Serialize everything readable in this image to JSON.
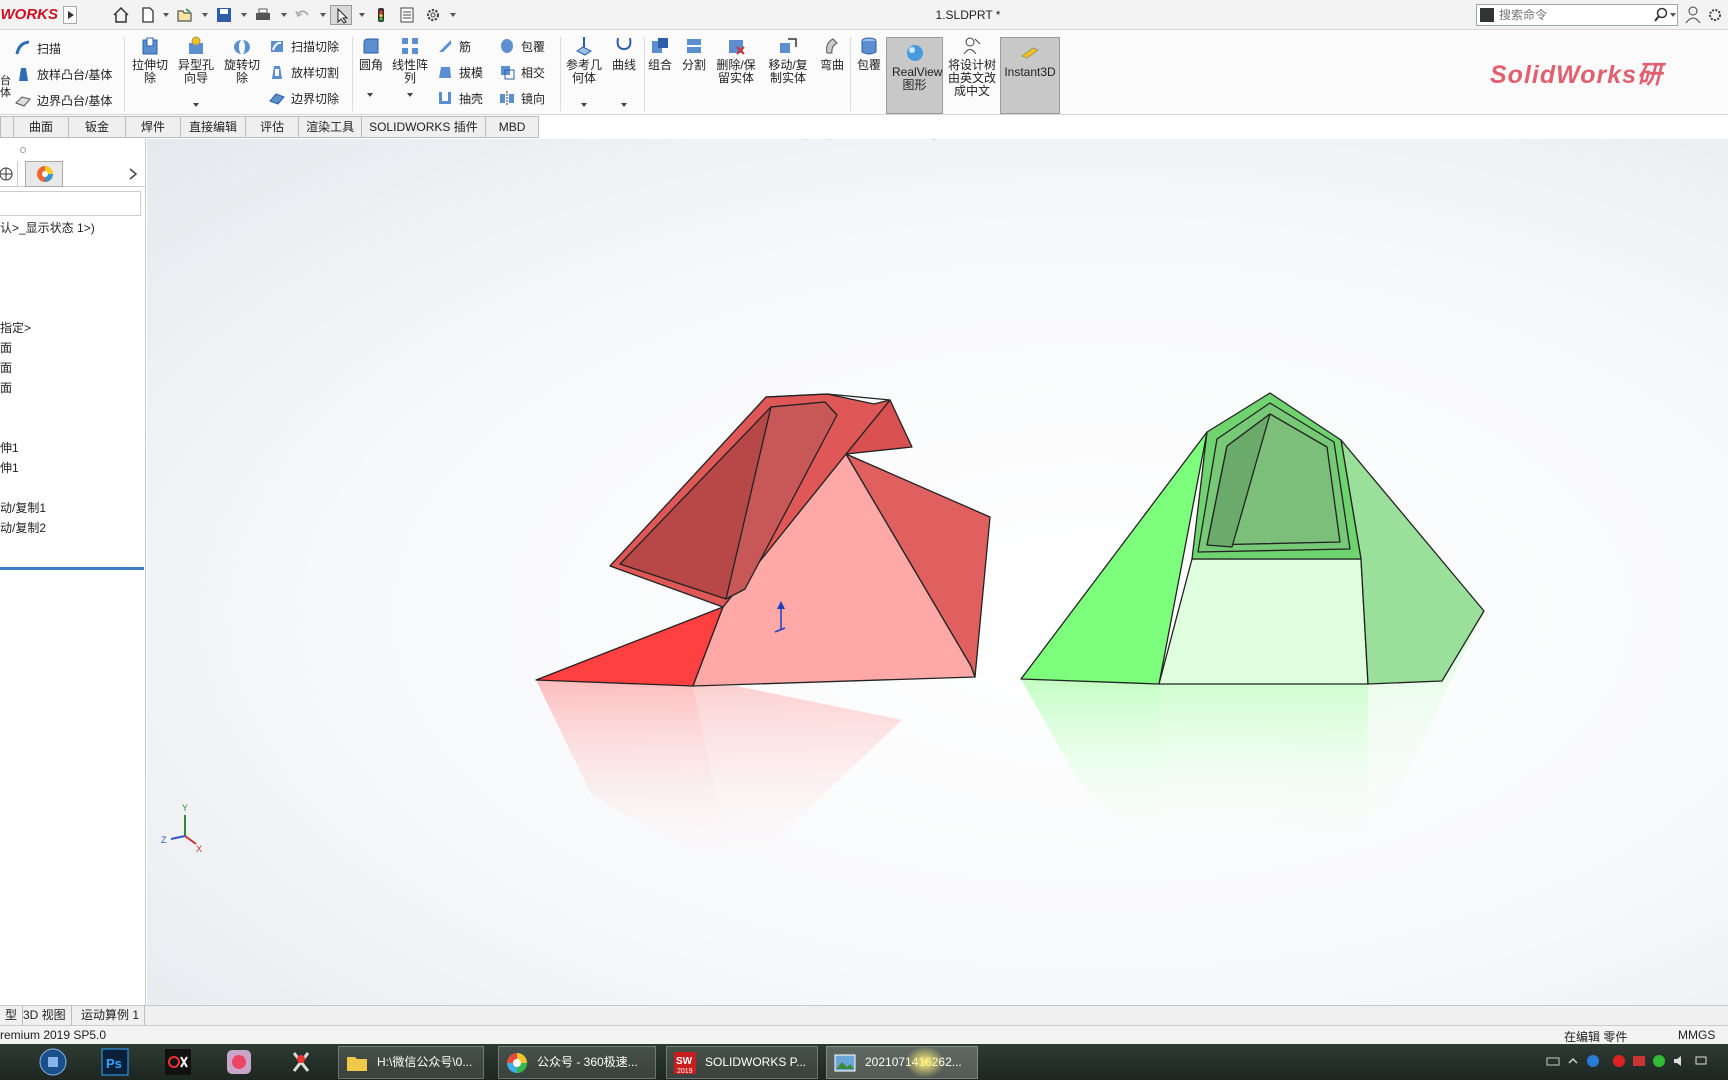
{
  "titlebar": {
    "brand": "WORKS",
    "doc_title": "1.SLDPRT *",
    "search_placeholder": "搜索命令"
  },
  "ribbon": {
    "left_items": [
      "扫描",
      "放样凸台/基体",
      "边界凸台/基体"
    ],
    "left_edge_text": [
      "台",
      "体"
    ],
    "big_buttons": [
      "拉伸切除",
      "异型孔向导",
      "旋转切除"
    ],
    "cut_items": [
      "扫描切除",
      "放样切割",
      "边界切除"
    ],
    "feature_big": [
      "圆角",
      "线性阵列"
    ],
    "feature_small": [
      "筋",
      "拔模",
      "抽壳"
    ],
    "feature_small2": [
      "包覆",
      "相交",
      "镜向"
    ],
    "ref_big": [
      "参考几何体",
      "曲线"
    ],
    "body_big": [
      "组合",
      "分割",
      "删除/保留实体",
      "移动/复制实体",
      "弯曲",
      "包覆"
    ],
    "realview": "RealView图形",
    "translate": "将设计树由英文改成中文",
    "instant3d": "Instant3D",
    "logo": "SolidWorks研"
  },
  "tabs": [
    "曲面",
    "钣金",
    "焊件",
    "直接编辑",
    "评估",
    "渲染工具",
    "SOLIDWORKS 插件",
    "MBD"
  ],
  "tree": {
    "display_state": "认>_显示状态 1>)",
    "material": "指定>",
    "planes": [
      "面",
      "面",
      "面"
    ],
    "features": [
      "伸1",
      "伸1"
    ],
    "moves": [
      "动/复制1",
      "动/复制2"
    ]
  },
  "bottom_tabs": [
    "型",
    "3D 视图",
    "运动算例 1"
  ],
  "status": {
    "version": "remium 2019 SP5.0",
    "mode": "在编辑 零件",
    "units": "MMGS"
  },
  "taskbar": {
    "buttons": [
      {
        "label": "H:\\微信公众号\\0...",
        "icon": "folder-icon"
      },
      {
        "label": "公众号 - 360极速...",
        "icon": "browser-icon"
      },
      {
        "label": "SOLIDWORKS P...",
        "icon": "solidworks-icon"
      },
      {
        "label": "2021071416262...",
        "icon": "image-viewer-icon"
      }
    ],
    "sw_year": "2019"
  },
  "colors": {
    "red_body": "#ff4a4a",
    "green_body": "#77ff77",
    "brand_red": "#d01020",
    "selection_blue": "#3d7fc4"
  }
}
